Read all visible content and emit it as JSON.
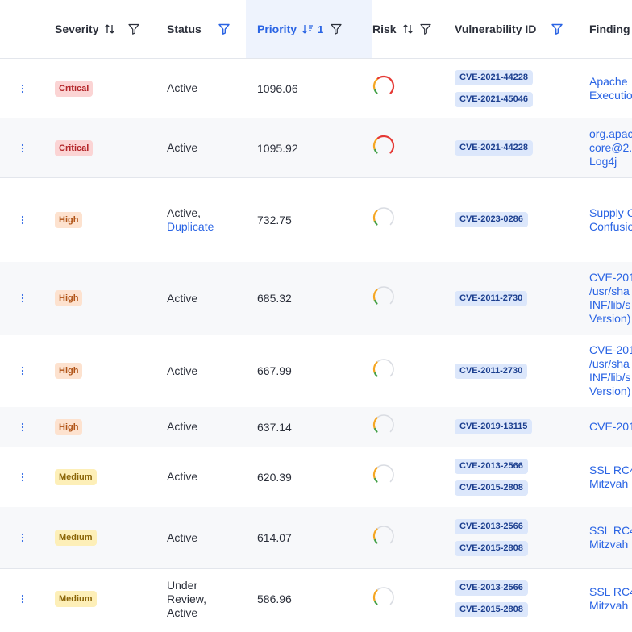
{
  "header": {
    "severity": "Severity",
    "status": "Status",
    "priority": "Priority",
    "priority_sort_count": "1",
    "risk": "Risk",
    "vulnerability_id": "Vulnerability ID",
    "finding": "Finding"
  },
  "colors": {
    "accent": "#2a64e4",
    "critical": "#b3262a",
    "high": "#b05316",
    "medium": "#8a6508",
    "risk_red": "#e53935",
    "risk_orange": "#f5a623",
    "risk_green": "#43a047",
    "risk_track": "#d9dce2"
  },
  "rows": [
    {
      "severity": "Critical",
      "status": "Active",
      "status_line2": "",
      "priority": "1096.06",
      "risk_level": "high",
      "cves": [
        "CVE-2021-44228",
        "CVE-2021-45046"
      ],
      "finding": [
        "Apache",
        "Executio"
      ]
    },
    {
      "severity": "Critical",
      "status": "Active",
      "status_line2": "",
      "priority": "1095.92",
      "risk_level": "high",
      "cves": [
        "CVE-2021-44228"
      ],
      "finding": [
        "org.apac",
        "core@2.",
        "Log4j"
      ]
    },
    {
      "severity": "High",
      "status": "Active,",
      "status_line2": "Duplicate",
      "priority": "732.75",
      "risk_level": "low",
      "cves": [
        "CVE-2023-0286"
      ],
      "finding": [
        "Supply C",
        "Confusio"
      ]
    },
    {
      "severity": "High",
      "status": "Active",
      "status_line2": "",
      "priority": "685.32",
      "risk_level": "low",
      "cves": [
        "CVE-2011-2730"
      ],
      "finding": [
        "CVE-201",
        "/usr/sha",
        "INF/lib/s",
        "Version)"
      ]
    },
    {
      "severity": "High",
      "status": "Active",
      "status_line2": "",
      "priority": "667.99",
      "risk_level": "low",
      "cves": [
        "CVE-2011-2730"
      ],
      "finding": [
        "CVE-201",
        "/usr/sha",
        "INF/lib/s",
        "Version)"
      ]
    },
    {
      "severity": "High",
      "status": "Active",
      "status_line2": "",
      "priority": "637.14",
      "risk_level": "low",
      "cves": [
        "CVE-2019-13115"
      ],
      "finding": [
        "CVE-201"
      ]
    },
    {
      "severity": "Medium",
      "status": "Active",
      "status_line2": "",
      "priority": "620.39",
      "risk_level": "low",
      "cves": [
        "CVE-2013-2566",
        "CVE-2015-2808"
      ],
      "finding": [
        "SSL RC4",
        "Mitzvah"
      ]
    },
    {
      "severity": "Medium",
      "status": "Active",
      "status_line2": "",
      "priority": "614.07",
      "risk_level": "low",
      "cves": [
        "CVE-2013-2566",
        "CVE-2015-2808"
      ],
      "finding": [
        "SSL RC4",
        "Mitzvah"
      ]
    },
    {
      "severity": "Medium",
      "status": "Under Review, Active",
      "status_line2": "",
      "priority": "586.96",
      "risk_level": "low",
      "cves": [
        "CVE-2013-2566",
        "CVE-2015-2808"
      ],
      "finding": [
        "SSL RC4",
        "Mitzvah"
      ]
    }
  ]
}
